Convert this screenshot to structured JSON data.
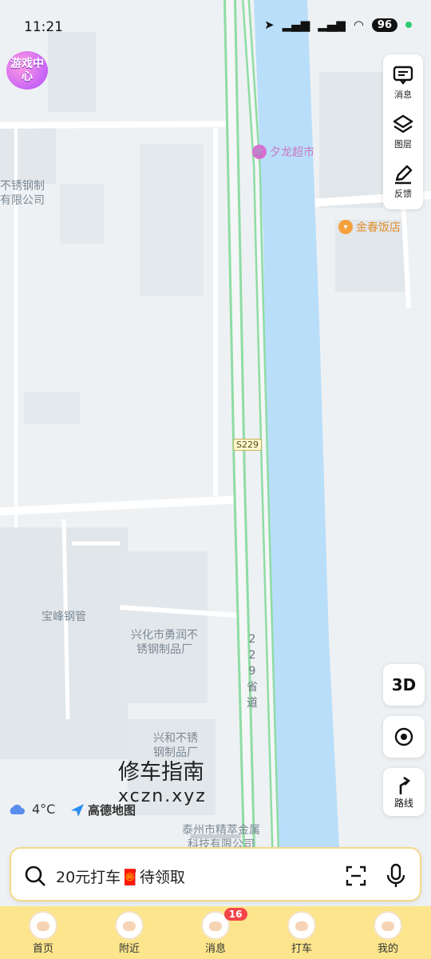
{
  "status_bar": {
    "time": "11:21",
    "battery": "96"
  },
  "game_center": {
    "label": "游戏中心"
  },
  "tools": [
    {
      "name": "消息",
      "icon": "message-icon"
    },
    {
      "name": "图层",
      "icon": "layers-icon"
    },
    {
      "name": "反馈",
      "icon": "feedback-icon"
    }
  ],
  "map_labels": {
    "steel_top": "不锈钢制\n有限公司",
    "baofeng": "宝峰钢管",
    "yongrun": "兴化市勇润不\n锈钢制品厂",
    "xinghe": "兴和不锈\n钢制品厂",
    "jingcui": "泰州市精萃金属\n科技有限公司",
    "road_badge": "S229",
    "road_vertical": "229省道",
    "poi_supermarket": "夕龙超市",
    "poi_restaurant": "金春饭店"
  },
  "buttons": {
    "three_d": "3D",
    "route": "路线"
  },
  "weather": {
    "temp": "4°C",
    "logo": "高德地图"
  },
  "watermark": {
    "title": "修车指南",
    "site": "xczn.xyz"
  },
  "search": {
    "text": "20元打车🧧待领取"
  },
  "nav": [
    {
      "label": "首页",
      "badge": ""
    },
    {
      "label": "附近",
      "badge": ""
    },
    {
      "label": "消息",
      "badge": "16"
    },
    {
      "label": "打车",
      "badge": ""
    },
    {
      "label": "我的",
      "badge": ""
    }
  ],
  "colors": {
    "river": "#b9defa",
    "road_green": "#8fdca4",
    "nav_bg": "#fce58c",
    "poi_pink": "#d96fd0",
    "poi_orange": "#f5a03a"
  }
}
